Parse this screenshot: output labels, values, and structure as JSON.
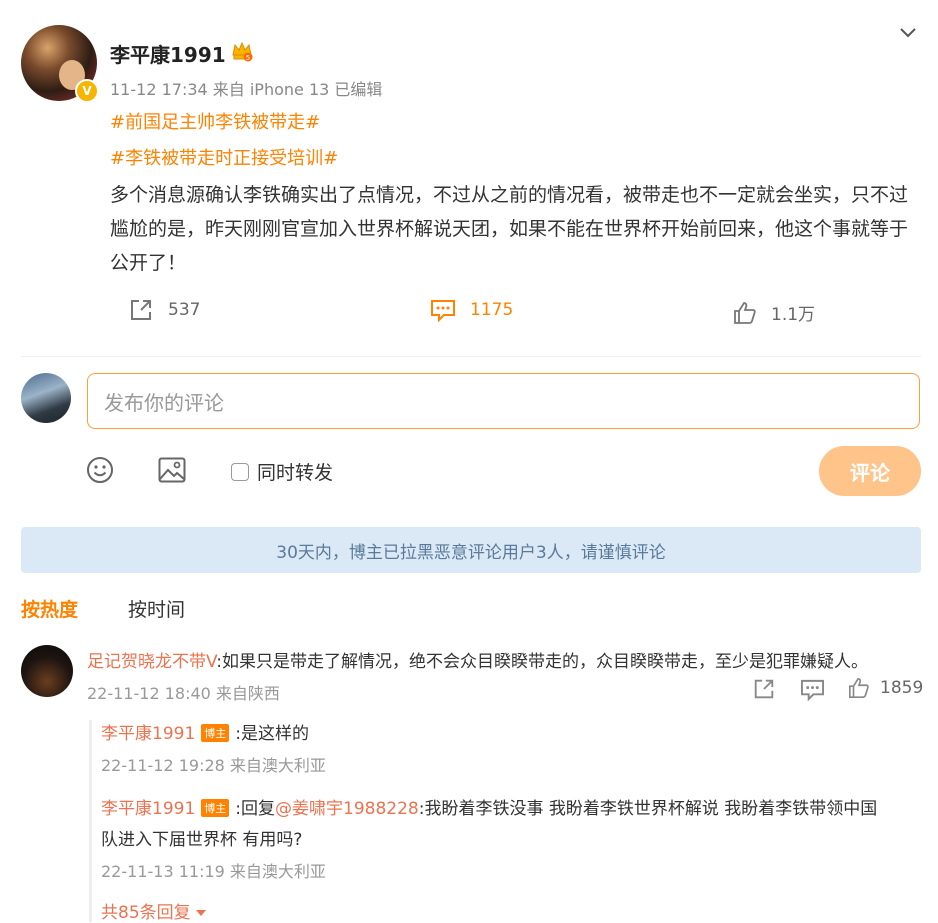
{
  "post": {
    "username": "李平康1991",
    "meta": "11-12 17:34 来自 iPhone 13 已编辑",
    "hashtags": [
      "#前国足主帅李铁被带走#",
      "#李铁被带走时正接受培训#"
    ],
    "content": "多个消息源确认李铁确实出了点情况，不过从之前的情况看，被带走也不一定就会坐实，只不过尴尬的是，昨天刚刚官宣加入世界杯解说天团，如果不能在世界杯开始前回来，他这个事就等于公开了！",
    "stats": {
      "reposts": "537",
      "comments": "1175",
      "likes": "1.1万"
    },
    "crown_level": "5",
    "verified_badge": "V"
  },
  "composer": {
    "placeholder": "发布你的评论",
    "repost_label": "同时转发",
    "submit_label": "评论"
  },
  "notice": "30天内，博主已拉黑恶意评论用户3人，请谨慎评论",
  "sort": {
    "hot": "按热度",
    "time": "按时间"
  },
  "comment": {
    "author": "足记贺晓龙不带V",
    "text": ":如果只是带走了解情况，绝不会众目睽睽带走的，众目睽睽带走，至少是犯罪嫌疑人。",
    "meta": "22-11-12 18:40 来自陕西",
    "likes": "1859"
  },
  "replies": [
    {
      "author": "李平康1991",
      "badge": "博主",
      "text": ":是这样的",
      "meta": "22-11-12 19:28 来自澳大利亚"
    },
    {
      "author": "李平康1991",
      "badge": "博主",
      "prefix": ":回复",
      "mention": "@姜啸宇1988228",
      "text_line1": ":我盼着李铁没事 我盼着李铁世界杯解说 我盼着李铁带领中国",
      "text_line2": "队进入下届世界杯 有用吗?",
      "meta": "22-11-13 11:19 来自澳大利亚"
    }
  ],
  "more_replies": "共85条回复",
  "colors": {
    "accent": "#ff8200",
    "link": "#eb7350",
    "notice_bg": "#dbe9f6"
  },
  "icons": [
    "chevron-down-icon",
    "repost-icon",
    "comment-icon",
    "like-icon",
    "emoji-icon",
    "image-icon",
    "crown-icon"
  ]
}
